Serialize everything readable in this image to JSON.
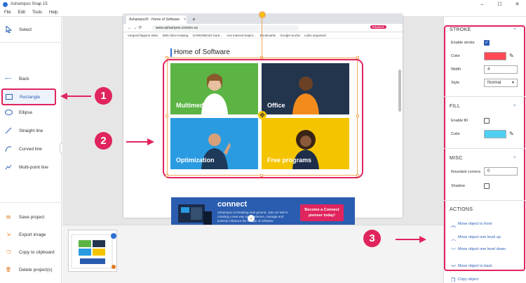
{
  "window": {
    "title": "Ashampoo Snap 15",
    "controls": [
      "–",
      "☐",
      "✕"
    ]
  },
  "menu": [
    "File",
    "Edit",
    "Tools",
    "Help"
  ],
  "sidebar": {
    "select": "Select",
    "tools": [
      "Back",
      "Rectangle",
      "Ellipse",
      "Straight line",
      "Curved line",
      "Multi-point line"
    ],
    "selected": "Rectangle",
    "actions": [
      "Save project",
      "Export image",
      "Copy to clipboard",
      "Delete project(s)"
    ],
    "collapse": "‹"
  },
  "browser": {
    "tab_title": "Ashampoo® - Home of Software",
    "tab_close": "×",
    "new_tab": "+",
    "url": "www.ashampoo.com/en-us",
    "profile": "Pausiert",
    "bookmarks": [
      "Vorgeschlagene Sites",
      "Web Slice-Katalog",
      "GARDINEUM Gard...",
      "Aus Internet Explor...",
      "Bookmarks",
      "Google-Suche",
      "Links anpassen"
    ],
    "page_title": "Home of Software",
    "tiles": [
      {
        "label": "Multimedia",
        "color": "#5bb444"
      },
      {
        "label": "Office",
        "color": "#22354d"
      },
      {
        "label": "Optimization",
        "color": "#2a9be0"
      },
      {
        "label": "Free programs",
        "color": "#f5c400"
      }
    ],
    "banner": {
      "brand": "connect",
      "text": "Ashampoo is breaking new ground. Join us! We're creating a new way to experience, manage and actively influence the design of software.",
      "button": "Become a Connect pioneer today!"
    }
  },
  "right_panel": {
    "stroke": {
      "title": "STROKE",
      "enable_label": "Enable stroke",
      "enabled": true,
      "color_label": "Color",
      "color": "#ff4a55",
      "width_label": "Width",
      "width": "4",
      "style_label": "Style",
      "style": "Normal"
    },
    "fill": {
      "title": "FILL",
      "enable_label": "Enable fill",
      "enabled": false,
      "color_label": "Color",
      "color": "#4fd0f2"
    },
    "misc": {
      "title": "MISC",
      "corners_label": "Rounded corners",
      "corners": "0",
      "shadow_label": "Shadow",
      "shadow": false
    },
    "actions": {
      "title": "ACTIONS",
      "items": [
        "Move object to front",
        "Move object one level up",
        "Move object one level down",
        "Move object to back",
        "Copy object"
      ]
    }
  },
  "annotations": [
    "1",
    "2",
    "3"
  ],
  "accent": "#e0245e"
}
